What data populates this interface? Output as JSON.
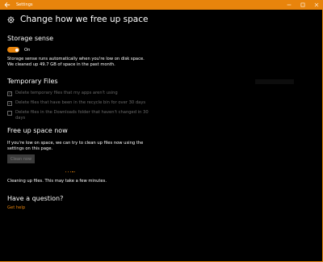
{
  "window": {
    "title": "Settings"
  },
  "colors": {
    "accent": "#e8840c",
    "background": "#000000",
    "disabled": "#6a6a6a"
  },
  "header": {
    "icon": "gear-icon",
    "title": "Change how we free up space"
  },
  "storage_sense": {
    "title": "Storage sense",
    "toggle_label": "On",
    "toggle_on": true,
    "description_line1": "Storage sense runs automatically when you're low on disk space.",
    "description_line2": "We cleaned up 49.7 GB of space in the past month."
  },
  "temporary_files": {
    "title": "Temporary Files",
    "options": [
      {
        "label": "Delete temporary files that my apps aren't using",
        "checked": true
      },
      {
        "label": "Delete files that have been in the recycle bin for over 30 days",
        "checked": true
      },
      {
        "label_line1": "Delete files in the Downloads folder that haven't changed in 30",
        "label_line2": "days",
        "checked": false
      }
    ]
  },
  "free_up": {
    "title": "Free up space now",
    "description_line1": "If you're low on space, we can try to clean up files now using the",
    "description_line2": "settings on this page.",
    "button_label": "Clean now",
    "status": "Cleaning up files. This may take a few minutes."
  },
  "question": {
    "title": "Have a question?",
    "link": "Get help"
  }
}
